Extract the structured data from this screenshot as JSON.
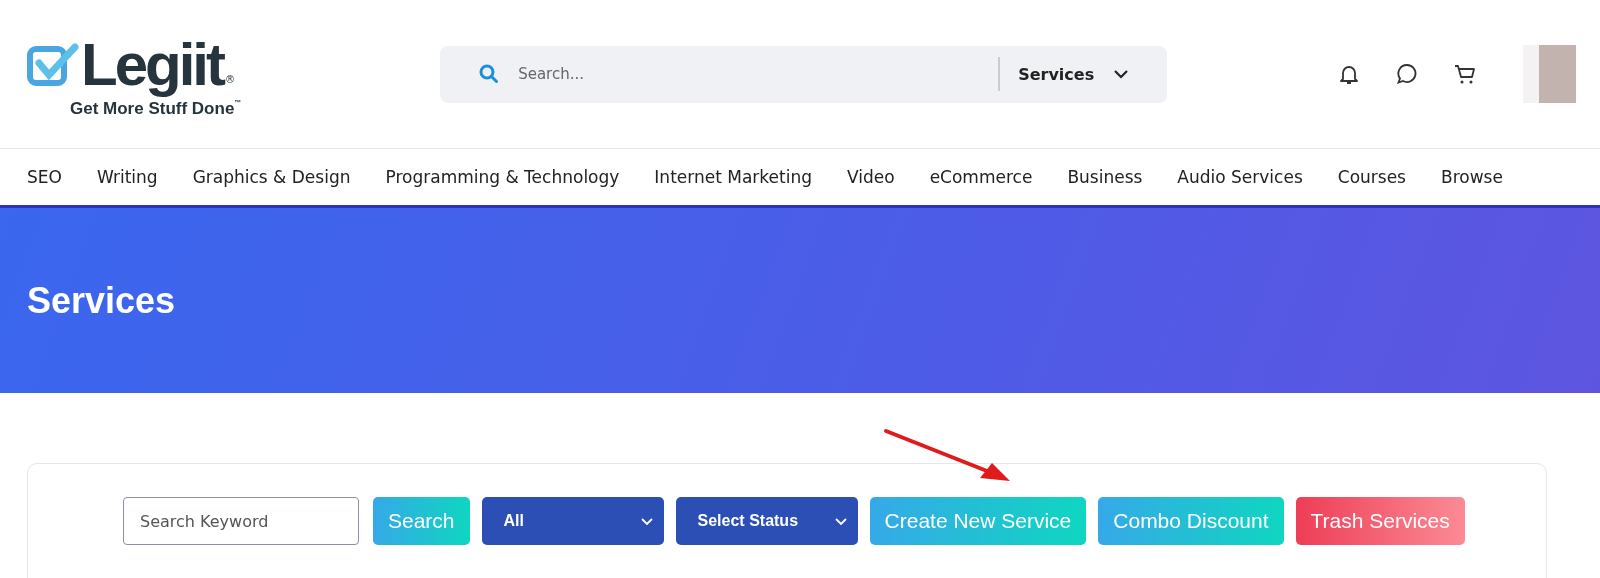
{
  "logo": {
    "name": "Legiit",
    "registered": "®",
    "tagline": "Get More Stuff Done",
    "trademark": "™"
  },
  "search": {
    "placeholder": "Search...",
    "category": "Services"
  },
  "nav": [
    "SEO",
    "Writing",
    "Graphics & Design",
    "Programming & Technology",
    "Internet Marketing",
    "Video",
    "eCommerce",
    "Business",
    "Audio Services",
    "Courses",
    "Browse"
  ],
  "banner": {
    "title": "Services"
  },
  "toolbar": [
    {
      "kind": "input",
      "placeholder": "Search Keyword"
    },
    {
      "kind": "teal",
      "label": "Search"
    },
    {
      "kind": "select",
      "label": "All"
    },
    {
      "kind": "select",
      "label": "Select Status"
    },
    {
      "kind": "teal",
      "label": "Create New Service"
    },
    {
      "kind": "teal",
      "label": "Combo Discount"
    },
    {
      "kind": "red",
      "label": "Trash Services"
    }
  ]
}
